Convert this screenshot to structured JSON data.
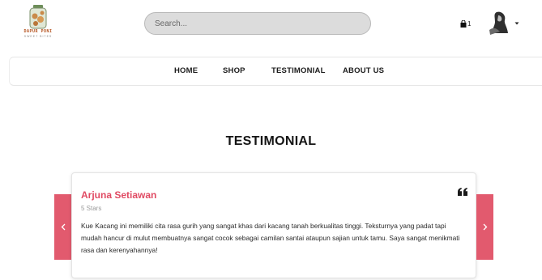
{
  "header": {
    "logo": {
      "name": "DAPUR PONI",
      "tagline": "SWEET BITES"
    },
    "search": {
      "placeholder": "Search..."
    },
    "cart": {
      "count": "1"
    }
  },
  "nav": {
    "items": [
      {
        "label": "HOME"
      },
      {
        "label": "SHOP"
      },
      {
        "label": "TESTIMONIAL"
      },
      {
        "label": "ABOUT US"
      }
    ]
  },
  "section": {
    "title": "TESTIMONIAL"
  },
  "testimonial": {
    "name": "Arjuna Setiawan",
    "rating_text": "5 Stars",
    "text": "Kue Kacang ini memiliki cita rasa gurih yang sangat khas dari kacang tanah berkualitas tinggi. Teksturnya yang padat tapi mudah hancur di mulut membuatnya sangat cocok sebagai camilan santai ataupun sajian untuk tamu. Saya sangat menikmati rasa dan kerenyahannya!"
  },
  "colors": {
    "accent": "#e25a6e",
    "name_color": "#e04a63",
    "search_bg": "#dcdcdc"
  },
  "icons": [
    "logo-jar-icon",
    "cart-icon",
    "avatar",
    "caret-down-icon",
    "quote-icon",
    "chevron-left-icon",
    "chevron-right-icon"
  ]
}
